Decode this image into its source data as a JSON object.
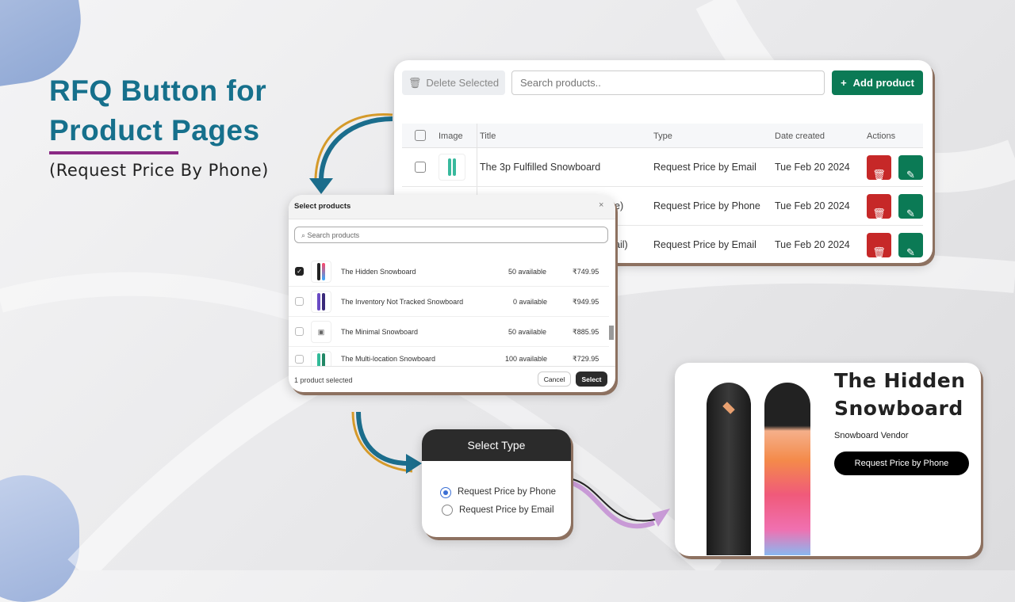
{
  "hero": {
    "title_line1": "RFQ Button for",
    "title_line2": "Product Pages",
    "subtitle": "(Request Price By Phone)",
    "accent": "#16708c",
    "underline": "#8a2a84"
  },
  "table_card": {
    "delete_selected": "Delete Selected",
    "search_placeholder": "Search products..",
    "add_product": "Add product",
    "headers": [
      "Image",
      "Title",
      "Type",
      "Date created",
      "Actions"
    ],
    "rows": [
      {
        "title": "The 3p Fulfilled Snowboard",
        "type": "Request Price by Email",
        "date": "Tue Feb 20 2024"
      },
      {
        "title": "e)",
        "type": "Request Price by Phone",
        "date": "Tue Feb 20 2024"
      },
      {
        "title": "ail)",
        "type": "Request Price by Email",
        "date": "Tue Feb 20 2024"
      }
    ],
    "colors": {
      "delete": "#c62828",
      "edit": "#0b7a55"
    }
  },
  "select_modal": {
    "title": "Select products",
    "search_placeholder": "Search products",
    "items": [
      {
        "name": "The Hidden Snowboard",
        "stock": "50 available",
        "price": "₹749.95",
        "checked": true
      },
      {
        "name": "The Inventory Not Tracked Snowboard",
        "stock": "0 available",
        "price": "₹949.95",
        "checked": false
      },
      {
        "name": "The Minimal Snowboard",
        "stock": "50 available",
        "price": "₹885.95",
        "checked": false
      },
      {
        "name": "The Multi-location Snowboard",
        "stock": "100 available",
        "price": "₹729.95",
        "checked": false
      }
    ],
    "status": "1 product selected",
    "cancel": "Cancel",
    "select": "Select"
  },
  "select_type": {
    "title": "Select Type",
    "options": [
      {
        "label": "Request Price by Phone",
        "selected": true
      },
      {
        "label": "Request Price by Email",
        "selected": false
      }
    ]
  },
  "product_card": {
    "title_line1": "The Hidden",
    "title_line2": "Snowboard",
    "vendor": "Snowboard Vendor",
    "button": "Request Price by Phone"
  }
}
